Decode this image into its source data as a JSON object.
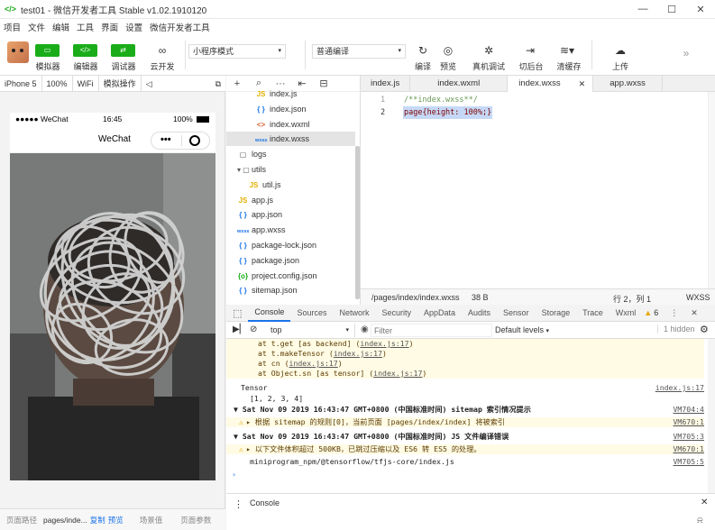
{
  "window": {
    "title": "test01 - 微信开发者工具 Stable v1.02.1910120",
    "min": "—",
    "max": "☐",
    "close": "✕"
  },
  "menu": [
    "项目",
    "文件",
    "编辑",
    "工具",
    "界面",
    "设置",
    "微信开发者工具"
  ],
  "toolbar": {
    "simulator": "模拟器",
    "editor": "编辑器",
    "debugger": "调试器",
    "cloud": "云开发",
    "mode_select": "小程序模式",
    "compile_select": "普通编译",
    "compile": "编译",
    "preview": "预览",
    "real_debug": "真机调试",
    "switch_bg": "切后台",
    "clear_cache": "清缓存",
    "upload": "上传"
  },
  "device_bar": {
    "device": "iPhone 5",
    "zoom": "100%",
    "network": "WiFi",
    "sim_ops": "模拟操作"
  },
  "phone": {
    "carrier": "●●●●● WeChat",
    "time": "16:45",
    "battery": "100%",
    "nav_title": "WeChat",
    "capsule_dots": "•••"
  },
  "sim_bottom": {
    "page_path_label": "页面路径",
    "page_path": "pages/inde...",
    "copy": "复制",
    "preview": "预览",
    "scene": "场景值",
    "params": "页面参数"
  },
  "file_tree": [
    {
      "icon": "JS",
      "name": "index.js",
      "indent": 2
    },
    {
      "icon": "{ }",
      "name": "index.json",
      "indent": 2
    },
    {
      "icon": "<>",
      "name": "index.wxml",
      "indent": 2
    },
    {
      "icon": "wxss",
      "name": "index.wxss",
      "indent": 2,
      "selected": true
    },
    {
      "icon": "▢",
      "name": "logs",
      "indent": 0
    },
    {
      "icon": "▾ ▢",
      "name": "utils",
      "indent": 0
    },
    {
      "icon": "JS",
      "name": "util.js",
      "indent": 1
    },
    {
      "icon": "JS",
      "name": "app.js",
      "indent": 0
    },
    {
      "icon": "{ }",
      "name": "app.json",
      "indent": 0
    },
    {
      "icon": "wxss",
      "name": "app.wxss",
      "indent": 0
    },
    {
      "icon": "{ }",
      "name": "package-lock.json",
      "indent": 0
    },
    {
      "icon": "{ }",
      "name": "package.json",
      "indent": 0
    },
    {
      "icon": "{o}",
      "name": "project.config.json",
      "indent": 0
    },
    {
      "icon": "{ }",
      "name": "sitemap.json",
      "indent": 0
    }
  ],
  "editor_tabs": [
    "index.js",
    "index.wxml",
    "index.wxss",
    "app.wxss"
  ],
  "editor_tab_close": "✕",
  "code": [
    {
      "num": "1",
      "text": "/**index.wxss**/"
    },
    {
      "num": "2",
      "text": "page{height: 100%;}"
    }
  ],
  "editor_status": {
    "path": "/pages/index/index.wxss",
    "size": "38 B",
    "position": "行 2，列 1",
    "lang": "WXSS"
  },
  "devtools_tabs": [
    "Console",
    "Sources",
    "Network",
    "Security",
    "AppData",
    "Audits",
    "Sensor",
    "Storage",
    "Trace",
    "Wxml"
  ],
  "devtools_warn_count": "6",
  "console_toolbar": {
    "context": "top",
    "filter_placeholder": "Filter",
    "levels": "Default levels",
    "hidden": "1 hidden"
  },
  "console_lines": [
    {
      "type": "warn",
      "indent": true,
      "text": "at t.get [as backend] (",
      "link": "index.js:17",
      "tail": ")"
    },
    {
      "type": "warn",
      "indent": true,
      "text": "at t.makeTensor (",
      "link": "index.js:17",
      "tail": ")"
    },
    {
      "type": "warn",
      "indent": true,
      "text": "at cn (",
      "link": "index.js:17",
      "tail": ")"
    },
    {
      "type": "warn",
      "indent": true,
      "text": "at Object.sn [as tensor] (",
      "link": "index.js:17",
      "tail": ")"
    },
    {
      "type": "log",
      "text": "Tensor",
      "src": "index.js:17"
    },
    {
      "type": "log",
      "indent": true,
      "text": "[1, 2, 3, 4]"
    },
    {
      "type": "group",
      "text": "▼ Sat Nov 09 2019 16:43:47 GMT+0800 (中国标准时间) sitemap 索引情况提示",
      "src": "VM704:4"
    },
    {
      "type": "warn",
      "icon": "⚠",
      "text": "▸ 根据 sitemap 的规则[0]，当前页面 [pages/index/index] 将被索引",
      "src": "VM670:1"
    },
    {
      "type": "group",
      "text": "▼ Sat Nov 09 2019 16:43:47 GMT+0800 (中国标准时间) JS 文件编译错误",
      "src": "VM705:3"
    },
    {
      "type": "warn",
      "icon": "⚠",
      "text": "▸ 以下文件体积超过 500KB，已跳过压缩以及 ES6 转 ES5 的处理。",
      "src": "VM670:1"
    },
    {
      "type": "log",
      "indent": true,
      "text": "miniprogram_npm/@tensorflow/tfjs-core/index.js",
      "src": "VM705:5"
    }
  ],
  "console_prompt": "›",
  "drawer_tab": "Console",
  "drawer_close": "✕"
}
